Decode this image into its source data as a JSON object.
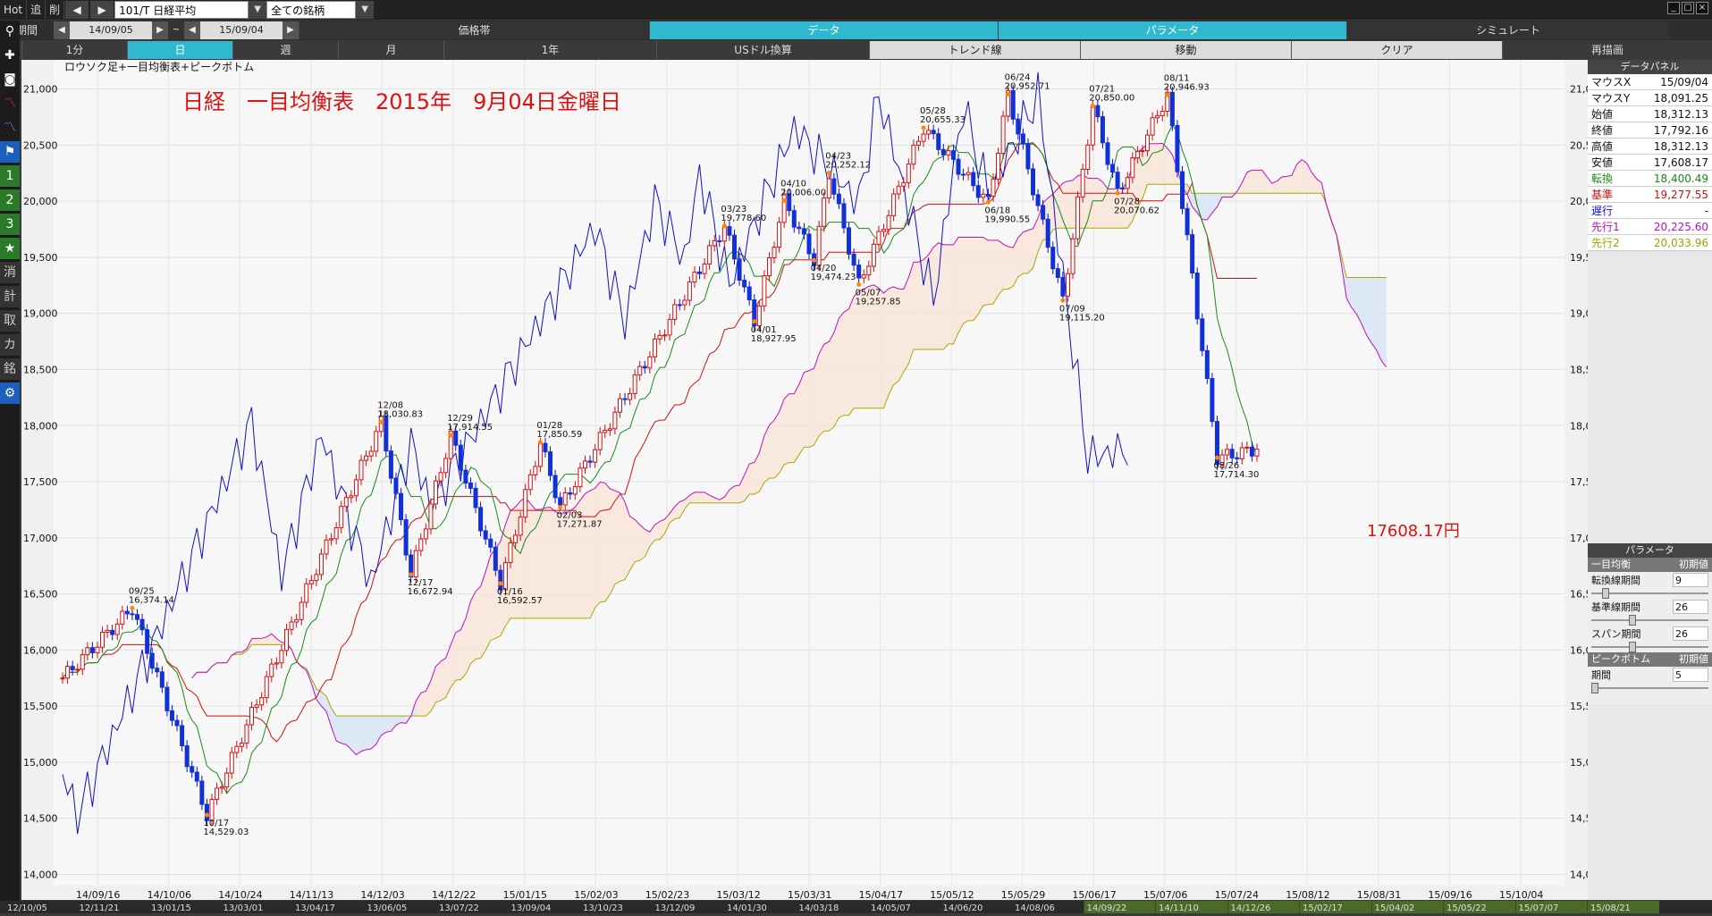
{
  "topbar": {
    "hot": "Hot",
    "tsui": "追",
    "saku": "削",
    "symbol": "101/T 日経平均",
    "universe": "全ての銘柄"
  },
  "row1": {
    "kikan": "期間",
    "date_from": "14/09/05",
    "tilde": "~",
    "date_to": "15/09/04",
    "tabs": [
      "価格帯",
      "データ",
      "パラメータ",
      "シミュレート"
    ]
  },
  "row2": {
    "tabs": [
      "1分",
      "日",
      "週",
      "月",
      "1年",
      "USドル換算",
      "トレンド線",
      "移動",
      "クリア",
      "再描画"
    ]
  },
  "sidebar": {
    "items": [
      "1",
      "2",
      "3",
      "消",
      "計",
      "取",
      "カ",
      "銘"
    ]
  },
  "chart_data": {
    "type": "candlestick",
    "subtitle": "ロウソク足+一目均衡表+ピークボトム",
    "title": "日経　一目均衡表　2015年　9月04日金曜日",
    "price_note": "17608.17円",
    "ylim": [
      14000,
      21200
    ],
    "yticks": [
      "14,000",
      "14,500",
      "15,000",
      "15,500",
      "16,000",
      "16,500",
      "17,000",
      "17,500",
      "18,000",
      "18,500",
      "19,000",
      "19,500",
      "20,000",
      "20,500",
      "21,000"
    ],
    "xticks": [
      "14/09/16",
      "14/10/06",
      "14/10/24",
      "14/11/13",
      "14/12/03",
      "14/12/22",
      "15/01/15",
      "15/02/03",
      "15/02/23",
      "15/03/12",
      "15/03/31",
      "15/04/17",
      "15/05/12",
      "15/05/29",
      "15/06/17",
      "15/07/06",
      "15/07/24",
      "15/08/12",
      "15/08/31",
      "15/09/16",
      "15/10/04"
    ],
    "bottom_axis": [
      "12/10/05",
      "12/11/21",
      "13/01/15",
      "13/03/01",
      "13/04/17",
      "13/06/05",
      "13/07/22",
      "13/09/04",
      "13/10/23",
      "13/12/09",
      "14/01/30",
      "14/03/18",
      "14/05/07",
      "14/06/20",
      "14/08/06",
      "14/09/22",
      "14/11/10",
      "14/12/26",
      "15/02/17",
      "15/04/02",
      "15/05/22",
      "15/07/07",
      "15/08/21"
    ],
    "series_names": [
      "転換",
      "基準",
      "遅行",
      "先行1",
      "先行2"
    ],
    "peaks": [
      {
        "date": "09/25",
        "value": "16,374.14",
        "i": 14,
        "v": 16374,
        "pos": "top"
      },
      {
        "date": "10/17",
        "value": "14,529.03",
        "i": 29,
        "v": 14529,
        "pos": "bottom"
      },
      {
        "date": "12/08",
        "value": "18,030.83",
        "i": 64,
        "v": 18031,
        "pos": "top"
      },
      {
        "date": "12/17",
        "value": "16,672.94",
        "i": 70,
        "v": 16673,
        "pos": "bottom"
      },
      {
        "date": "12/29",
        "value": "17,914.55",
        "i": 78,
        "v": 17915,
        "pos": "top"
      },
      {
        "date": "01/16",
        "value": "16,592.57",
        "i": 88,
        "v": 16593,
        "pos": "bottom"
      },
      {
        "date": "01/28",
        "value": "17,850.59",
        "i": 96,
        "v": 17851,
        "pos": "top"
      },
      {
        "date": "02/03",
        "value": "17,271.87",
        "i": 100,
        "v": 17272,
        "pos": "bottom"
      },
      {
        "date": "03/23",
        "value": "19,778.60",
        "i": 133,
        "v": 19779,
        "pos": "top"
      },
      {
        "date": "04/01",
        "value": "18,927.95",
        "i": 139,
        "v": 18928,
        "pos": "bottom"
      },
      {
        "date": "04/10",
        "value": "20,006.00",
        "i": 145,
        "v": 20006,
        "pos": "top"
      },
      {
        "date": "04/20",
        "value": "19,474.23",
        "i": 151,
        "v": 19474,
        "pos": "bottom"
      },
      {
        "date": "04/23",
        "value": "20,252.12",
        "i": 154,
        "v": 20252,
        "pos": "top"
      },
      {
        "date": "05/07",
        "value": "19,257.85",
        "i": 160,
        "v": 19258,
        "pos": "bottom"
      },
      {
        "date": "05/28",
        "value": "20,655.33",
        "i": 173,
        "v": 20655,
        "pos": "top"
      },
      {
        "date": "06/18",
        "value": "19,990.55",
        "i": 186,
        "v": 19991,
        "pos": "bottom"
      },
      {
        "date": "06/24",
        "value": "20,952.71",
        "i": 190,
        "v": 20953,
        "pos": "top"
      },
      {
        "date": "07/09",
        "value": "19,115.20",
        "i": 201,
        "v": 19115,
        "pos": "bottom"
      },
      {
        "date": "07/21",
        "value": "20,850.00",
        "i": 207,
        "v": 20850,
        "pos": "top"
      },
      {
        "date": "07/28",
        "value": "20,070.62",
        "i": 212,
        "v": 20071,
        "pos": "bottom"
      },
      {
        "date": "08/11",
        "value": "20,946.93",
        "i": 222,
        "v": 20947,
        "pos": "top"
      },
      {
        "date": "08/26",
        "value": "17,714.30",
        "i": 232,
        "v": 17714,
        "pos": "bottom"
      }
    ]
  },
  "data_panel": {
    "title": "データパネル",
    "rows": [
      {
        "label": "マウスX",
        "value": "15/09/04",
        "color": "#111"
      },
      {
        "label": "マウスY",
        "value": "18,091.25",
        "color": "#111"
      },
      {
        "label": "始値",
        "value": "18,312.13",
        "color": "#111"
      },
      {
        "label": "終値",
        "value": "17,792.16",
        "color": "#111"
      },
      {
        "label": "高値",
        "value": "18,312.13",
        "color": "#111"
      },
      {
        "label": "安値",
        "value": "17,608.17",
        "color": "#111"
      },
      {
        "label": "転換",
        "value": "18,400.49",
        "color": "#1a8a1a"
      },
      {
        "label": "基準",
        "value": "19,277.55",
        "color": "#d01010"
      },
      {
        "label": "遅行",
        "value": "-",
        "color": "#1010c8"
      },
      {
        "label": "先行1",
        "value": "20,225.60",
        "color": "#c010c0"
      },
      {
        "label": "先行2",
        "value": "20,033.96",
        "color": "#a0a000"
      }
    ]
  },
  "param_panel": {
    "title": "パラメータ",
    "ichimoku": "一目均衡",
    "init": "初期値",
    "rows": [
      {
        "label": "転換線期間",
        "value": "9",
        "pct": 0.1
      },
      {
        "label": "基準線期間",
        "value": "26",
        "pct": 0.35
      },
      {
        "label": "スパン期間",
        "value": "26",
        "pct": 0.35
      }
    ],
    "peak": "ピークボトム",
    "peak_init": "初期値",
    "peak_row": {
      "label": "期間",
      "value": "5",
      "pct": 0.0
    }
  }
}
